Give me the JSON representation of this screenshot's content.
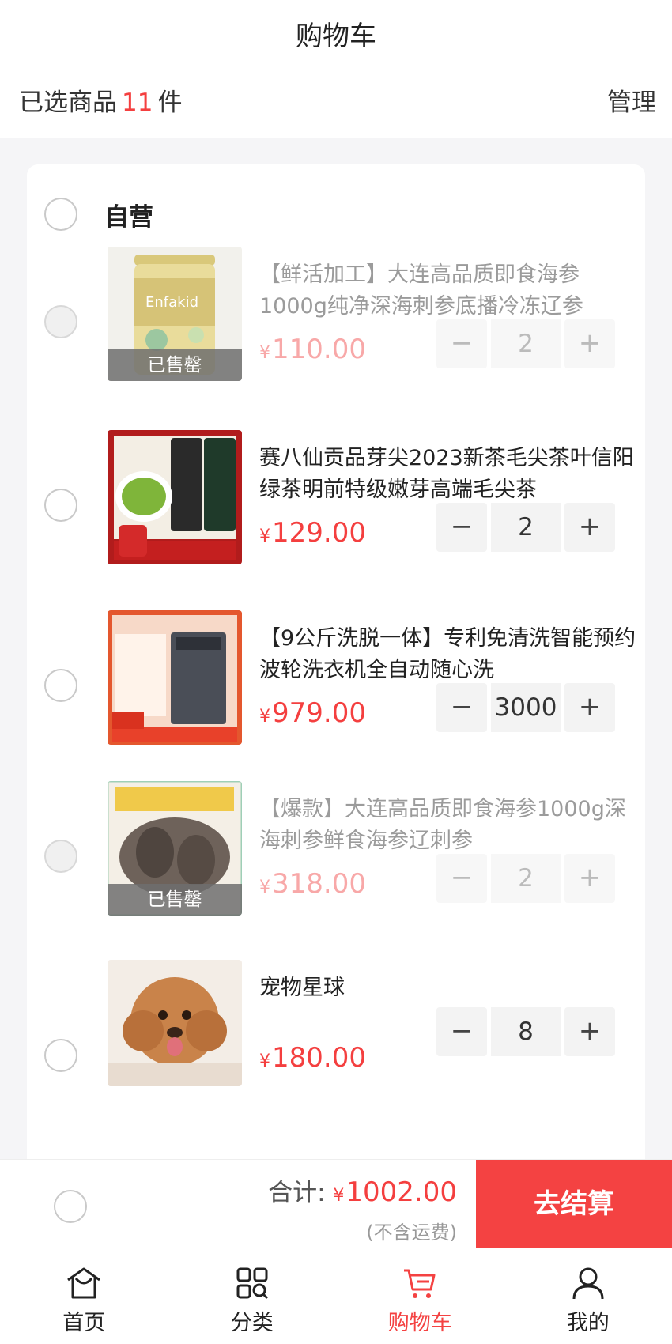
{
  "header": {
    "title": "购物车",
    "selected_prefix": "已选商品",
    "selected_count": "11",
    "selected_suffix": "件",
    "manage": "管理"
  },
  "shop": {
    "name": "自营"
  },
  "items": [
    {
      "title": "【鲜活加工】大连高品质即食海参1000g纯净深海刺参底播冷冻辽参",
      "currency": "¥",
      "price": "110.00",
      "qty": "2",
      "soldout": "已售罄",
      "status": "sold-out"
    },
    {
      "title": "赛八仙贡品芽尖2023新茶毛尖茶叶信阳绿茶明前特级嫩芽高端毛尖茶",
      "currency": "¥",
      "price": "129.00",
      "qty": "2",
      "status": "available"
    },
    {
      "title": "【9公斤洗脱一体】专利免清洗智能预约波轮洗衣机全自动随心洗",
      "currency": "¥",
      "price": "979.00",
      "qty": "3000",
      "status": "available"
    },
    {
      "title": "【爆款】大连高品质即食海参1000g深海刺参鲜食海参辽刺参",
      "currency": "¥",
      "price": "318.00",
      "qty": "2",
      "soldout": "已售罄",
      "status": "sold-out"
    },
    {
      "title": "宠物星球",
      "currency": "¥",
      "price": "180.00",
      "qty": "8",
      "status": "available"
    }
  ],
  "stepper": {
    "minus": "−",
    "plus": "+"
  },
  "footer": {
    "total_label": "合计:",
    "currency": "¥",
    "total": "1002.00",
    "shipping_note": "(不含运费)",
    "checkout": "去结算"
  },
  "tabs": [
    {
      "label": "首页",
      "icon": "home-icon"
    },
    {
      "label": "分类",
      "icon": "category-icon"
    },
    {
      "label": "购物车",
      "icon": "cart-icon",
      "active": true
    },
    {
      "label": "我的",
      "icon": "user-icon"
    }
  ],
  "colors": {
    "accent": "#f44242",
    "price": "#f43f3f",
    "background": "#f5f5f7"
  }
}
